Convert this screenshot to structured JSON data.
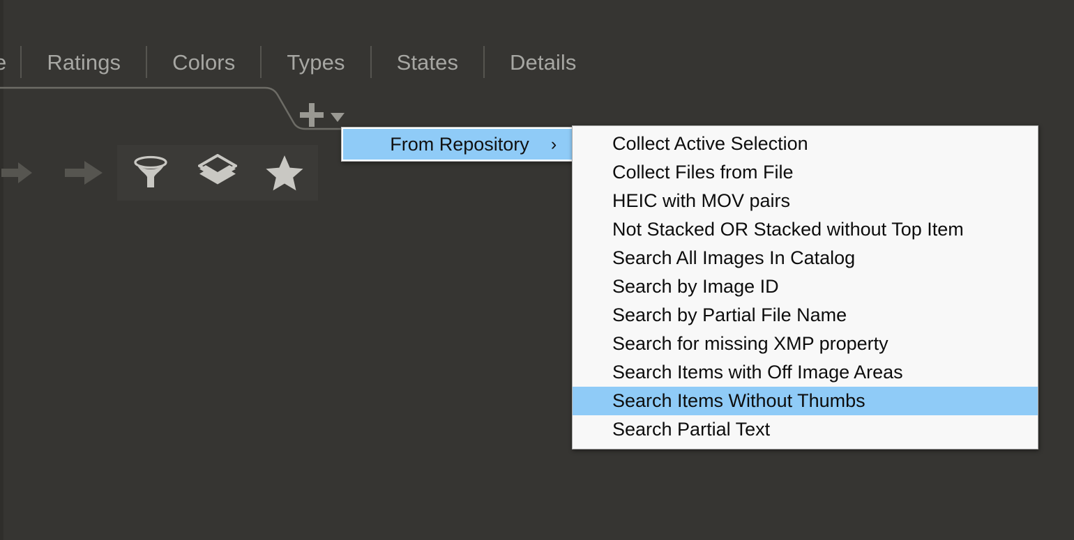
{
  "colors": {
    "app_background": "#363532",
    "tab_text": "#a7a7a3",
    "menu_background": "#f8f8f8",
    "menu_text": "#0d0d0d",
    "highlight": "#8fcbf7",
    "icon": "#c9c8c3",
    "icon_dim": "#565550"
  },
  "tabbar": {
    "tabs": [
      {
        "label": "e"
      },
      {
        "label": "Ratings"
      },
      {
        "label": "Colors"
      },
      {
        "label": "Types"
      },
      {
        "label": "States"
      },
      {
        "label": "Details"
      }
    ]
  },
  "panel": {
    "add_button": {
      "icon": "plus-icon",
      "dropdown_icon": "caret-down-icon"
    }
  },
  "toolbar": {
    "buttons": [
      {
        "name": "arrow-left-partial",
        "icon": "arrow-icon"
      },
      {
        "name": "arrow-right",
        "icon": "arrow-right-icon"
      },
      {
        "name": "filter",
        "icon": "funnel-icon"
      },
      {
        "name": "layers",
        "icon": "layers-icon"
      },
      {
        "name": "favorite",
        "icon": "star-icon"
      }
    ]
  },
  "submenu_parent": {
    "label": "From Repository",
    "arrow": "›",
    "selected": true
  },
  "menu": {
    "items": [
      {
        "label": "Collect Active Selection",
        "selected": false
      },
      {
        "label": "Collect Files from File",
        "selected": false
      },
      {
        "label": "HEIC with MOV pairs",
        "selected": false
      },
      {
        "label": "Not Stacked OR Stacked without Top Item",
        "selected": false
      },
      {
        "label": "Search All Images In Catalog",
        "selected": false
      },
      {
        "label": "Search by Image ID",
        "selected": false
      },
      {
        "label": "Search by Partial File Name",
        "selected": false
      },
      {
        "label": "Search for missing XMP property",
        "selected": false
      },
      {
        "label": "Search Items with Off Image Areas",
        "selected": false
      },
      {
        "label": "Search Items Without Thumbs",
        "selected": true
      },
      {
        "label": "Search Partial Text",
        "selected": false
      }
    ]
  }
}
